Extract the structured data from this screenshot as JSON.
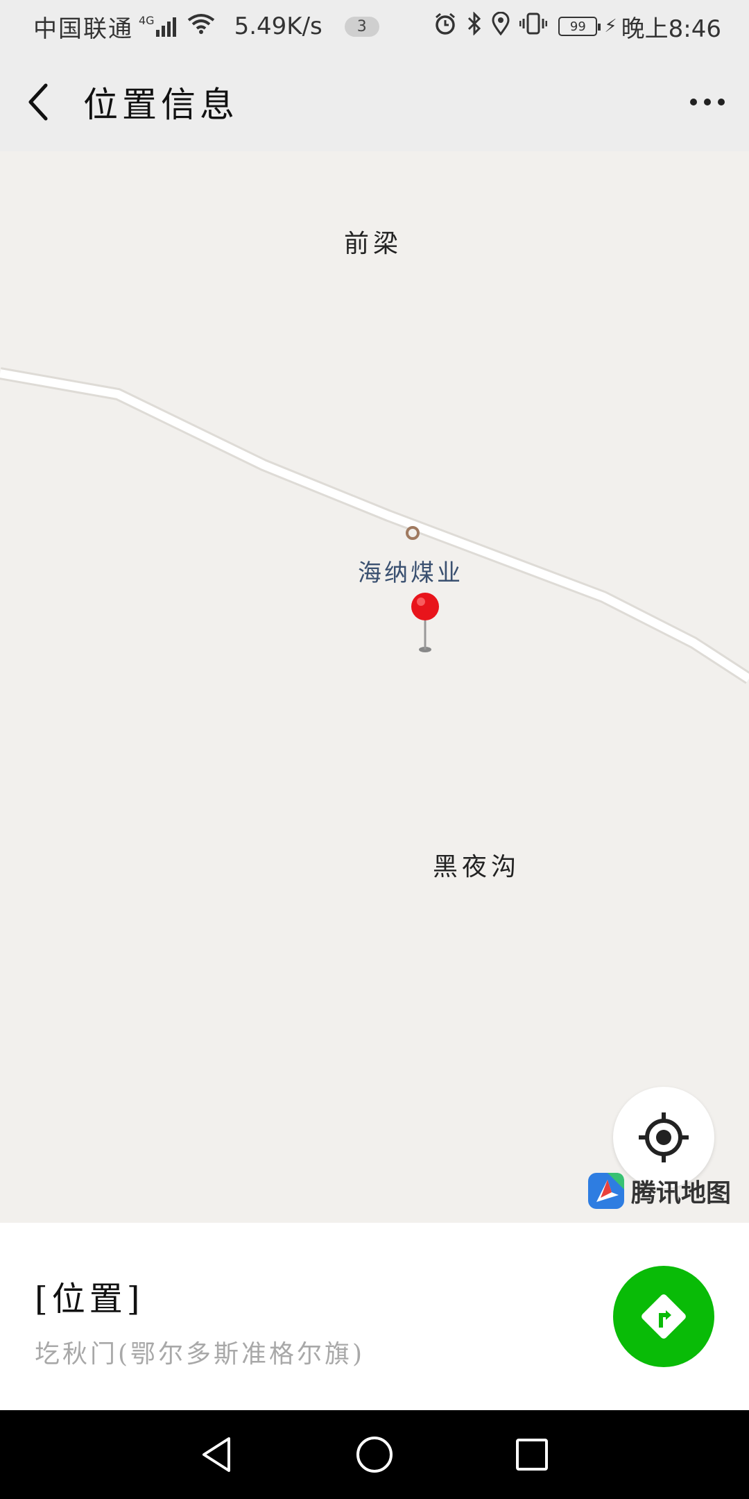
{
  "status_bar": {
    "carrier": "中国联通",
    "network": "4G",
    "speed": "5.49K/s",
    "notification_count": "3",
    "battery": "99",
    "time": "晚上8:46"
  },
  "header": {
    "title": "位置信息"
  },
  "map": {
    "places": {
      "qianliang": "前梁",
      "heiyegou": "黑夜沟"
    },
    "poi": "海纳煤业",
    "provider_logo_text": "腾讯地图"
  },
  "location": {
    "title": "[位置]",
    "address": "圪秋门(鄂尔多斯准格尔旗)"
  },
  "colors": {
    "navigate_green": "#09bb07",
    "pin_red": "#e8141b",
    "map_background": "#f2f0ed"
  },
  "icons": {
    "back": "chevron-left-icon",
    "more": "more-horizontal-icon",
    "locate": "crosshair-icon",
    "navigate": "navigation-diamond-icon",
    "nav_back": "triangle-back-icon",
    "nav_home": "circle-home-icon",
    "nav_recents": "square-recents-icon"
  }
}
